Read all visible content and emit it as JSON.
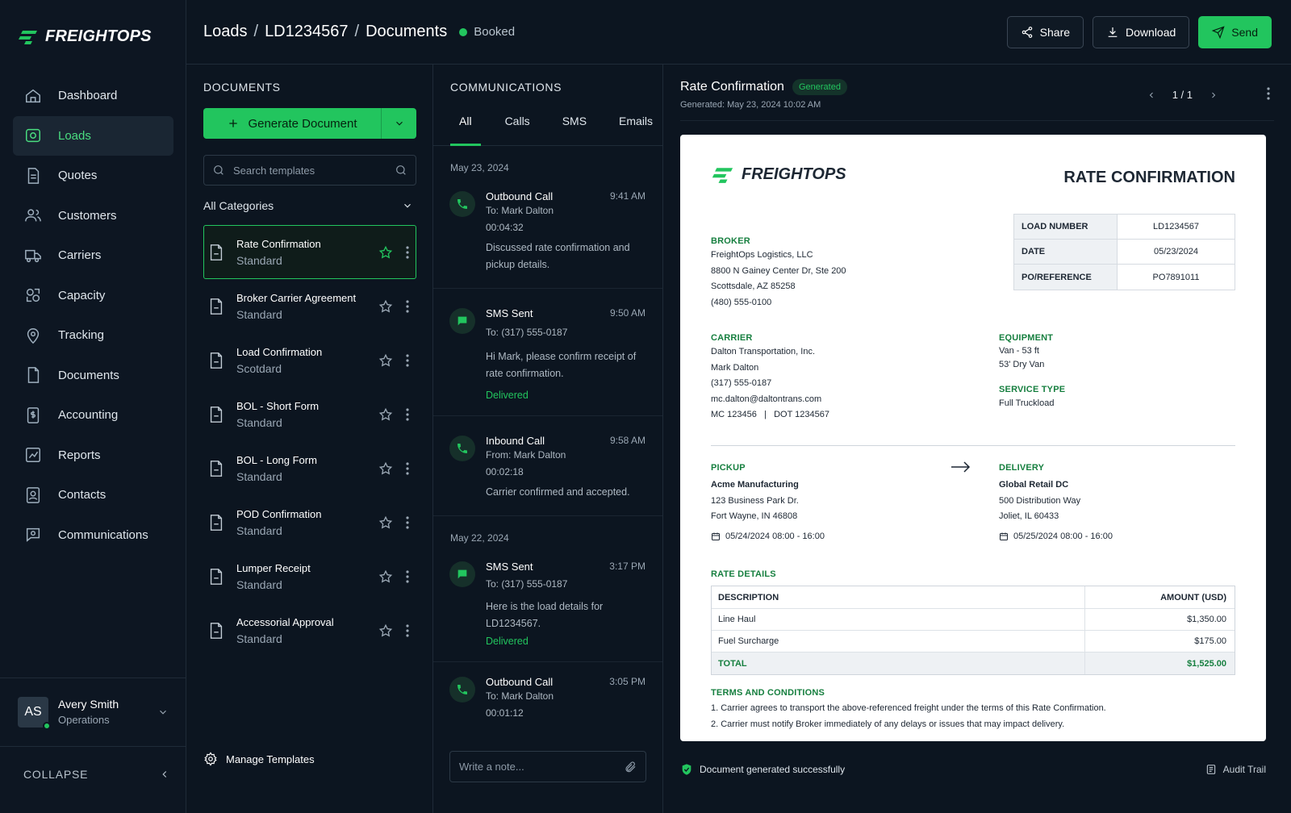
{
  "app": {
    "name": "FREIGHTOPS"
  },
  "sidebar": {
    "items": [
      {
        "label": "Dashboard",
        "icon": "home-icon"
      },
      {
        "label": "Loads",
        "icon": "truck-icon"
      },
      {
        "label": "Quotes",
        "icon": "quote-doc-icon"
      },
      {
        "label": "Customers",
        "icon": "users-icon"
      },
      {
        "label": "Carriers",
        "icon": "truck-outline-icon"
      },
      {
        "label": "Capacity",
        "icon": "capacity-icon"
      },
      {
        "label": "Tracking",
        "icon": "map-pin-icon"
      },
      {
        "label": "Documents",
        "icon": "document-icon"
      },
      {
        "label": "Accounting",
        "icon": "dollar-doc-icon"
      },
      {
        "label": "Reports",
        "icon": "chart-icon"
      },
      {
        "label": "Contacts",
        "icon": "contacts-icon"
      },
      {
        "label": "Communications",
        "icon": "chat-icon"
      }
    ],
    "user": {
      "initials": "AS",
      "name": "Avery Smith",
      "role": "Operations"
    },
    "collapse_label": "COLLAPSE"
  },
  "header": {
    "breadcrumb": [
      "Loads",
      "LD1234567",
      "Documents"
    ],
    "status": "Booked",
    "share_label": "Share",
    "download_label": "Download",
    "send_label": "Send"
  },
  "documents": {
    "title": "DOCUMENTS",
    "generate_label": "Generate Document",
    "search_placeholder": "Search templates",
    "category": "All Categories",
    "templates": [
      {
        "name": "Rate Confirmation",
        "sub": "Standard"
      },
      {
        "name": "Broker Carrier Agreement",
        "sub": "Standard"
      },
      {
        "name": "Load Confirmation",
        "sub": "Scotdard"
      },
      {
        "name": "BOL - Short Form",
        "sub": "Standard"
      },
      {
        "name": "BOL - Long Form",
        "sub": "Standard"
      },
      {
        "name": "POD Confirmation",
        "sub": "Standard"
      },
      {
        "name": "Lumper Receipt",
        "sub": "Standard"
      },
      {
        "name": "Accessorial Approval",
        "sub": "Standard"
      }
    ],
    "manage_label": "Manage Templates"
  },
  "communications": {
    "title": "COMMUNICATIONS",
    "tabs": [
      "All",
      "Calls",
      "SMS",
      "Emails"
    ],
    "groups": [
      {
        "date": "May 23, 2024",
        "entries": [
          {
            "type": "call",
            "title": "Outbound Call",
            "time": "9:41 AM",
            "line1": "To: Mark Dalton",
            "line2": "00:04:32",
            "msg": "Discussed rate confirmation and pickup details.",
            "status": ""
          },
          {
            "type": "sms",
            "title": "SMS Sent",
            "time": "9:50 AM",
            "line1": "To: (317) 555-0187",
            "line2": "",
            "msg": "Hi Mark, please confirm receipt of rate confirmation.",
            "status": "Delivered"
          },
          {
            "type": "call",
            "title": "Inbound Call",
            "time": "9:58 AM",
            "line1": "From: Mark Dalton",
            "line2": "00:02:18",
            "msg": "Carrier confirmed and accepted.",
            "status": ""
          }
        ]
      },
      {
        "date": "May 22, 2024",
        "entries": [
          {
            "type": "sms",
            "title": "SMS Sent",
            "time": "3:17 PM",
            "line1": "To: (317) 555-0187",
            "line2": "",
            "msg": "Here is the load details for LD1234567.",
            "status": "Delivered"
          },
          {
            "type": "call",
            "title": "Outbound Call",
            "time": "3:05 PM",
            "line1": "To: Mark Dalton",
            "line2": "00:01:12",
            "msg": "",
            "status": ""
          }
        ]
      }
    ],
    "note_placeholder": "Write a note..."
  },
  "preview": {
    "title": "Rate Confirmation",
    "badge": "Generated",
    "generated": "Generated: May 23, 2024 10:02 AM",
    "pager": "1 / 1",
    "footer_status": "Document generated successfully",
    "audit_label": "Audit Trail"
  },
  "doc": {
    "logo": "FREIGHTOPS",
    "title": "RATE CONFIRMATION",
    "meta": [
      {
        "k": "LOAD NUMBER",
        "v": "LD1234567"
      },
      {
        "k": "DATE",
        "v": "05/23/2024"
      },
      {
        "k": "PO/REFERENCE",
        "v": "PO7891011"
      }
    ],
    "broker_label": "BROKER",
    "broker": [
      "FreightOps Logistics, LLC",
      "8800 N Gainey Center Dr, Ste 200",
      "Scottsdale, AZ 85258",
      "(480) 555-0100"
    ],
    "carrier_label": "CARRIER",
    "carrier": [
      "Dalton Transportation, Inc.",
      "Mark Dalton",
      "(317) 555-0187",
      "mc.dalton@daltontrans.com",
      "MC 123456   |   DOT 1234567"
    ],
    "equipment_label": "EQUIPMENT",
    "equipment": [
      "Van - 53 ft",
      "53' Dry Van"
    ],
    "service_label": "SERVICE TYPE",
    "service": "Full Truckload",
    "pickup_label": "PICKUP",
    "pickup_name": "Acme Manufacturing",
    "pickup_addr": [
      "123 Business Park Dr.",
      "Fort Wayne, IN 46808"
    ],
    "pickup_window": "05/24/2024 08:00 - 16:00",
    "delivery_label": "DELIVERY",
    "delivery_name": "Global Retail DC",
    "delivery_addr": [
      "500 Distribution Way",
      "Joliet, IL 60433"
    ],
    "delivery_window": "05/25/2024 08:00 - 16:00",
    "rate_label": "RATE DETAILS",
    "rate_head": {
      "d": "DESCRIPTION",
      "a": "AMOUNT (USD)"
    },
    "rates": [
      {
        "d": "Line Haul",
        "a": "$1,350.00"
      },
      {
        "d": "Fuel Surcharge",
        "a": "$175.00"
      }
    ],
    "total": {
      "d": "TOTAL",
      "a": "$1,525.00"
    },
    "terms_label": "TERMS AND CONDITIONS",
    "terms": [
      "1. Carrier agrees to transport the above-referenced freight under the terms of this Rate Confirmation.",
      "2. Carrier must notify Broker immediately of any delays or issues that may impact delivery."
    ]
  }
}
